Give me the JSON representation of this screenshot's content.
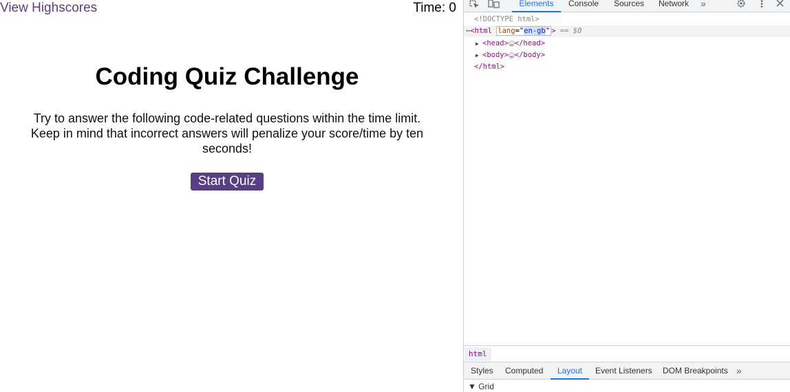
{
  "page": {
    "highscores_link": "View Highscores",
    "timer": "Time: 0",
    "title": "Coding Quiz Challenge",
    "description": "Try to answer the following code-related questions within the time limit. Keep in mind that incorrect answers will penalize your score/time by ten seconds!",
    "start_button": "Start Quiz",
    "accent_color": "#5a3e83"
  },
  "devtools": {
    "top_tabs": [
      "Elements",
      "Console",
      "Sources",
      "Network"
    ],
    "active_top_tab": "Elements",
    "more_tabs": "»",
    "dom": {
      "doctype": "<!DOCTYPE html>",
      "html_open": "<html",
      "attr_name": "lang",
      "attr_value": "en-gb",
      "html_close_bracket": ">",
      "selected_hint": "== $0",
      "head_open": "<head>",
      "head_close": "</head>",
      "body_open": "<body>",
      "body_close": "</body>",
      "html_end": "</html>",
      "ellipsis": "…"
    },
    "breadcrumb": "html",
    "panel_tabs": [
      "Styles",
      "Computed",
      "Layout",
      "Event Listeners",
      "DOM Breakpoints"
    ],
    "active_panel_tab": "Layout",
    "panel_more": "»",
    "grid_section": "▼ Grid"
  }
}
